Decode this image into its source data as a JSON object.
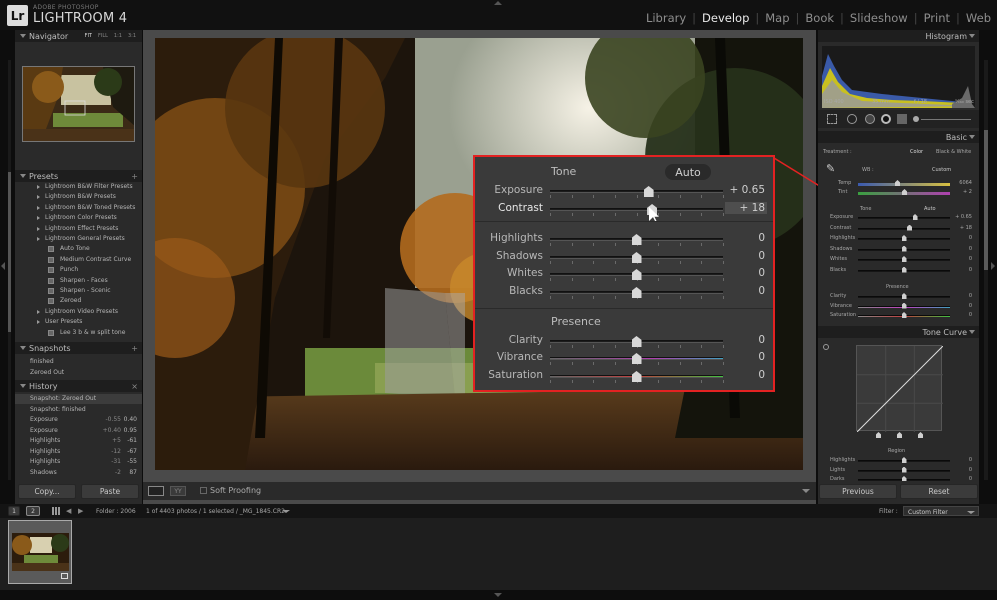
{
  "app": {
    "logo": "Lr",
    "brand_top": "ADOBE PHOTOSHOP",
    "brand_main": "LIGHTROOM 4"
  },
  "modules": [
    {
      "label": "Library",
      "active": false
    },
    {
      "label": "Develop",
      "active": true
    },
    {
      "label": "Map",
      "active": false
    },
    {
      "label": "Book",
      "active": false
    },
    {
      "label": "Slideshow",
      "active": false
    },
    {
      "label": "Print",
      "active": false
    },
    {
      "label": "Web",
      "active": false
    }
  ],
  "navigator": {
    "title": "Navigator",
    "zoom_options": [
      "FIT",
      "FILL",
      "1:1",
      "3:1"
    ]
  },
  "presets": {
    "title": "Presets",
    "items": [
      {
        "label": "Lightroom B&W Filter Presets",
        "level": 0
      },
      {
        "label": "Lightroom B&W Presets",
        "level": 0
      },
      {
        "label": "Lightroom B&W Toned Presets",
        "level": 0
      },
      {
        "label": "Lightroom Color Presets",
        "level": 0
      },
      {
        "label": "Lightroom Effect Presets",
        "level": 0
      },
      {
        "label": "Lightroom General Presets",
        "level": 0
      },
      {
        "label": "Auto Tone",
        "level": 1
      },
      {
        "label": "Medium Contrast Curve",
        "level": 1
      },
      {
        "label": "Punch",
        "level": 1
      },
      {
        "label": "Sharpen - Faces",
        "level": 1
      },
      {
        "label": "Sharpen - Scenic",
        "level": 1
      },
      {
        "label": "Zeroed",
        "level": 1
      },
      {
        "label": "Lightroom Video Presets",
        "level": 0
      },
      {
        "label": "User Presets",
        "level": 0
      },
      {
        "label": "Lee 3 b & w split tone",
        "level": 1
      }
    ]
  },
  "snapshots": {
    "title": "Snapshots",
    "items": [
      "finished",
      "Zeroed Out"
    ]
  },
  "history": {
    "title": "History",
    "items": [
      {
        "label": "Snapshot: Zeroed Out",
        "a": "",
        "b": ""
      },
      {
        "label": "Snapshot: finished",
        "a": "",
        "b": ""
      },
      {
        "label": "Exposure",
        "a": "-0.55",
        "b": "0.40"
      },
      {
        "label": "Exposure",
        "a": "+0.40",
        "b": "0.95"
      },
      {
        "label": "Highlights",
        "a": "+5",
        "b": "-61"
      },
      {
        "label": "Highlights",
        "a": "-12",
        "b": "-67"
      },
      {
        "label": "Highlights",
        "a": "-31",
        "b": "-55"
      },
      {
        "label": "Shadows",
        "a": "-2",
        "b": "87"
      }
    ]
  },
  "left_buttons": {
    "copy": "Copy...",
    "paste": "Paste"
  },
  "toolbar": {
    "soft_proofing": "Soft Proofing"
  },
  "histogram": {
    "title": "Histogram",
    "iso": "ISO 400",
    "focal": "35 mm",
    "aperture": "f / 18",
    "shutter": "¹⁄₁₆₀ sec"
  },
  "basic": {
    "title": "Basic",
    "treatment_label": "Treatment :",
    "treatment_color": "Color",
    "treatment_bw": "Black & White",
    "wb_label": "WB :",
    "wb_value": "Custom",
    "temp_label": "Temp",
    "temp_value": "6064",
    "tint_label": "Tint",
    "tint_value": "+ 2",
    "tone_label": "Tone",
    "auto_label": "Auto",
    "sliders": [
      {
        "label": "Exposure",
        "value": "+ 0.65",
        "pos": 0.62
      },
      {
        "label": "Contrast",
        "value": "+ 18",
        "pos": 0.56
      },
      {
        "label": "Highlights",
        "value": "0",
        "pos": 0.5
      },
      {
        "label": "Shadows",
        "value": "0",
        "pos": 0.5
      },
      {
        "label": "Whites",
        "value": "0",
        "pos": 0.5
      },
      {
        "label": "Blacks",
        "value": "0",
        "pos": 0.5
      }
    ],
    "presence_label": "Presence",
    "presence": [
      {
        "label": "Clarity",
        "value": "0",
        "pos": 0.5
      },
      {
        "label": "Vibrance",
        "value": "0",
        "pos": 0.5
      },
      {
        "label": "Saturation",
        "value": "0",
        "pos": 0.5
      }
    ]
  },
  "tone_curve": {
    "title": "Tone Curve",
    "region_label": "Region",
    "region": [
      {
        "label": "Highlights",
        "value": "0"
      },
      {
        "label": "Lights",
        "value": "0"
      },
      {
        "label": "Darks",
        "value": "0"
      }
    ]
  },
  "right_buttons": {
    "previous": "Previous",
    "reset": "Reset"
  },
  "callout": {
    "tone": "Tone",
    "auto": "Auto",
    "sliders": [
      {
        "label": "Exposure",
        "value": "+ 0.65",
        "pos": 0.57
      },
      {
        "label": "Contrast",
        "value": "+ 18",
        "pos": 0.59
      },
      {
        "label": "Highlights",
        "value": "0",
        "pos": 0.5
      },
      {
        "label": "Shadows",
        "value": "0",
        "pos": 0.5
      },
      {
        "label": "Whites",
        "value": "0",
        "pos": 0.5
      },
      {
        "label": "Blacks",
        "value": "0",
        "pos": 0.5
      }
    ],
    "presence": "Presence",
    "presence_sliders": [
      {
        "label": "Clarity",
        "value": "0",
        "pos": 0.5
      },
      {
        "label": "Vibrance",
        "value": "0",
        "pos": 0.5
      },
      {
        "label": "Saturation",
        "value": "0",
        "pos": 0.5
      }
    ]
  },
  "filmstrip": {
    "screen1": "1",
    "screen2": "2",
    "folder": "Folder : 2006",
    "count": "1 of 4403 photos / 1 selected / _MG_1845.CR2",
    "filter_label": "Filter :",
    "filter_value": "Custom Filter"
  },
  "colors": {
    "accent_red": "#e32222",
    "panel_bg": "#2c2c2c",
    "header_bg": "#1e1e1e"
  }
}
